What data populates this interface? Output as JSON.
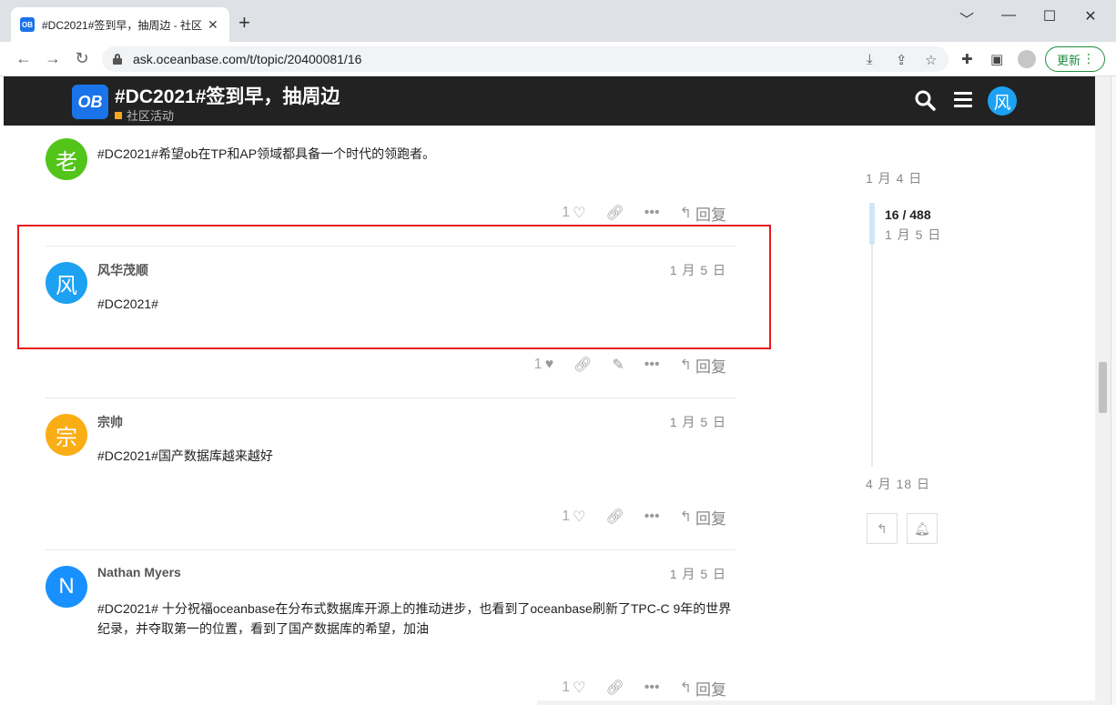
{
  "browser": {
    "tab_title": "#DC2021#签到早，抽周边 - 社区",
    "favicon_label": "OB",
    "new_tab": "+",
    "url": "ask.oceanbase.com/t/topic/20400081/16",
    "update_label": "更新",
    "window_controls": [
      "﹀",
      "—",
      "☐",
      "✕"
    ]
  },
  "header": {
    "logo_text": "OB",
    "title": "#DC2021#签到早，抽周边",
    "category": "社区活动",
    "category_color": "#f5a623",
    "user_avatar": "风"
  },
  "posts": [
    {
      "avatar": "老",
      "avatar_color": "#52c41a",
      "username": "",
      "date": "",
      "body": "#DC2021#希望ob在TP和AP领域都具备一个时代的领跑者。",
      "likes": "1",
      "reply_label": "回复"
    },
    {
      "avatar": "风",
      "avatar_color": "#1da1f2",
      "username": "风华茂顺",
      "date": "1 月 5 日",
      "body": "#DC2021#",
      "likes": "1",
      "reply_label": "回复"
    },
    {
      "avatar": "宗",
      "avatar_color": "#faad14",
      "username": "宗帅",
      "date": "1 月 5 日",
      "body": "#DC2021#国产数据库越来越好",
      "likes": "1",
      "reply_label": "回复"
    },
    {
      "avatar": "N",
      "avatar_color": "#1890ff",
      "username": "Nathan Myers",
      "date": "1 月 5 日",
      "body": "#DC2021# 十分祝福oceanbase在分布式数据库开源上的推动进步，也看到了oceanbase刷新了TPC-C 9年的世界纪录，并夺取第一的位置，看到了国产数据库的希望，加油",
      "likes": "1",
      "reply_label": "回复"
    }
  ],
  "timeline": {
    "top_date": "1 月 4 日",
    "progress": "16 / 488",
    "current_date": "1 月 5 日",
    "bottom_date": "4 月 18 日"
  }
}
